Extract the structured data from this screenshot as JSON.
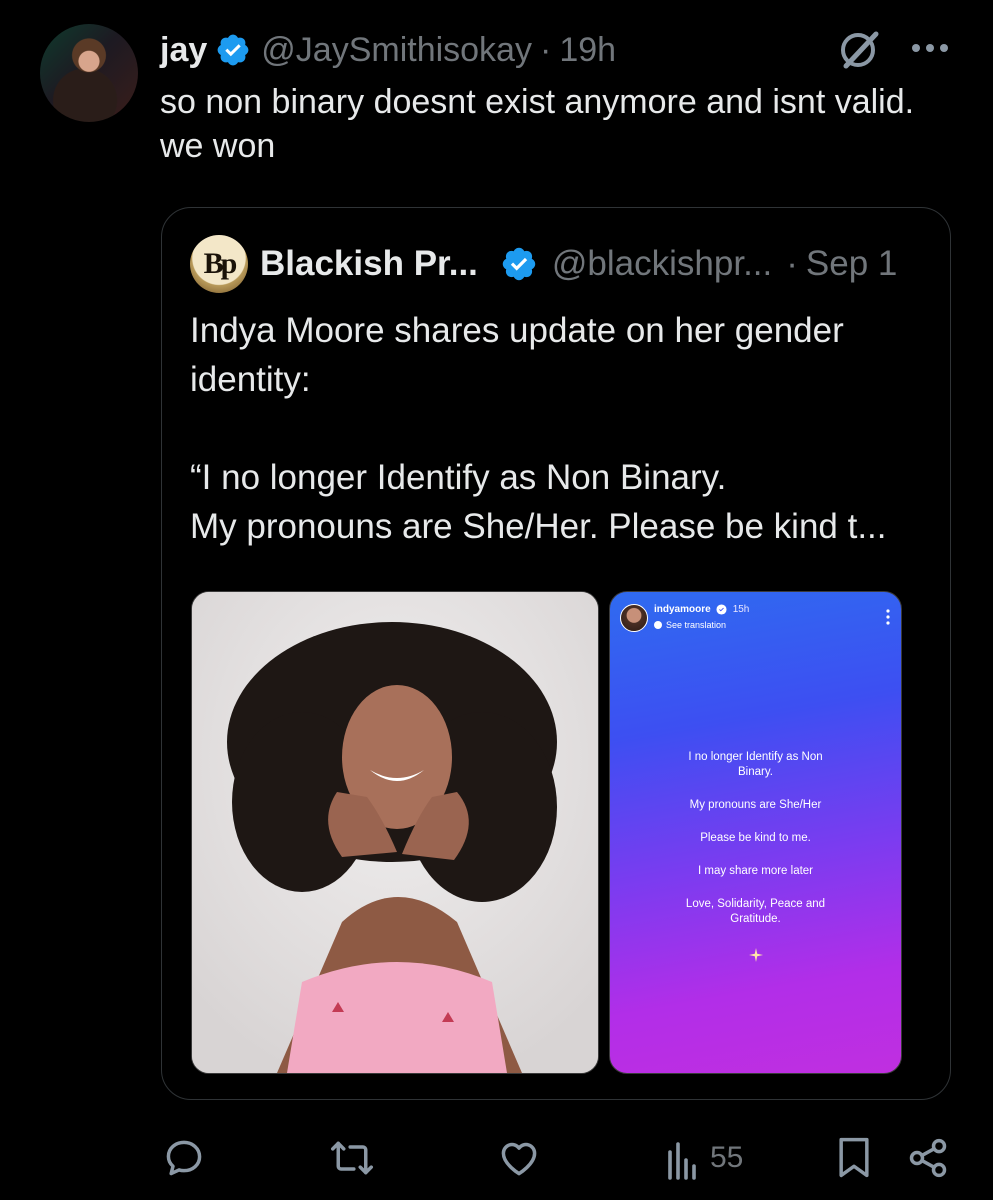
{
  "post": {
    "author_name": "jay",
    "author_handle": "@JaySmithisokay",
    "separator": "·",
    "time": "19h",
    "text": "so non binary doesnt exist anymore and isnt valid. we won"
  },
  "quoted_post": {
    "avatar_text": "Bp",
    "author_name": "Blackish Pr...",
    "author_handle": "@blackishpr...",
    "separator": "·",
    "date": "Sep 1",
    "text": "Indya Moore shares update on her gender identity:\n\n“I no longer Identify as Non Binary.\nMy pronouns are She/Her. Please be kind t...",
    "media": {
      "photo_alt": "portrait photo",
      "story": {
        "username": "indyamoore",
        "time": "15h",
        "see_translation": "See translation",
        "lines": [
          "I no longer Identify as Non Binary.",
          "My pronouns are She/Her",
          "Please be kind to me.",
          "I may share more later",
          "Love, Solidarity, Peace and Gratitude."
        ]
      }
    }
  },
  "actions": {
    "views_count": "55"
  },
  "icons": {
    "verified_color": "#1d9bf0",
    "muted_color": "#71767b",
    "reply": "reply-icon",
    "repost": "repost-icon",
    "like": "like-icon",
    "views": "views-icon",
    "bookmark": "bookmark-icon",
    "share": "share-icon",
    "grok": "grok-icon",
    "more": "more-icon"
  }
}
